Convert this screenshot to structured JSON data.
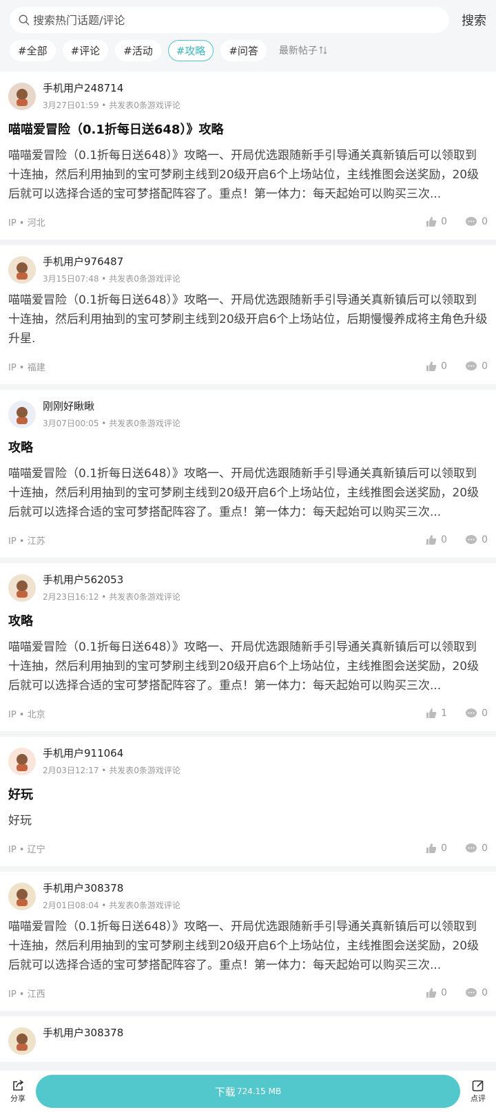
{
  "search": {
    "placeholder": "搜索热门话题/评论",
    "button": "搜索"
  },
  "tags": [
    "#全部",
    "#评论",
    "#活动",
    "#攻略",
    "#问答"
  ],
  "active_tag": "#攻略",
  "sort_label": "最新帖子",
  "posts": [
    {
      "user": "手机用户248714",
      "meta": "3月27日01:59 • 共发表0条游戏评论",
      "title": "喵喵爱冒险（0.1折每日送648）》攻略",
      "body": "喵喵爱冒险（0.1折每日送648）》攻略一、开局优选跟随新手引导通关真新镇后可以领取到十连抽，然后利用抽到的宝可梦刷主线到20级开启6个上场站位，主线推图会送奖励，20级后就可以选择合适的宝可梦搭配阵容了。重点！第一体力：每天起始可以购买三次...",
      "ip": "IP • 河北",
      "likes": "0",
      "comments": "0"
    },
    {
      "user": "手机用户976487",
      "meta": "3月15日07:48 • 共发表0条游戏评论",
      "title": "",
      "body": "喵喵爱冒险（0.1折每日送648）》攻略一、开局优选跟随新手引导通关真新镇后可以领取到十连抽，然后利用抽到的宝可梦刷主线到20级开启6个上场站位，后期慢慢养成将主角色升级升星.",
      "ip": "IP • 福建",
      "likes": "0",
      "comments": "0"
    },
    {
      "user": "刚刚好瞅瞅",
      "meta": "3月07日00:05 • 共发表0条游戏评论",
      "title": "攻略",
      "body": "喵喵爱冒险（0.1折每日送648）》攻略一、开局优选跟随新手引导通关真新镇后可以领取到十连抽，然后利用抽到的宝可梦刷主线到20级开启6个上场站位，主线推图会送奖励，20级后就可以选择合适的宝可梦搭配阵容了。重点！第一体力：每天起始可以购买三次...",
      "ip": "IP • 江苏",
      "likes": "0",
      "comments": "0"
    },
    {
      "user": "手机用户562053",
      "meta": "2月23日16:12 • 共发表0条游戏评论",
      "title": "攻略",
      "body": "喵喵爱冒险（0.1折每日送648）》攻略一、开局优选跟随新手引导通关真新镇后可以领取到十连抽，然后利用抽到的宝可梦刷主线到20级开启6个上场站位，主线推图会送奖励，20级后就可以选择合适的宝可梦搭配阵容了。重点！第一体力：每天起始可以购买三次...",
      "ip": "IP • 北京",
      "likes": "1",
      "comments": "0"
    },
    {
      "user": "手机用户911064",
      "meta": "2月03日12:17 • 共发表0条游戏评论",
      "title": "好玩",
      "body": "好玩",
      "ip": "IP • 辽宁",
      "likes": "0",
      "comments": "0"
    },
    {
      "user": "手机用户308378",
      "meta": "2月01日08:04 • 共发表0条游戏评论",
      "title": "",
      "body": "喵喵爱冒险（0.1折每日送648）》攻略一、开局优选跟随新手引导通关真新镇后可以领取到十连抽，然后利用抽到的宝可梦刷主线到20级开启6个上场站位，主线推图会送奖励，20级后就可以选择合适的宝可梦搭配阵容了。重点！第一体力：每天起始可以购买三次...",
      "ip": "IP • 江西",
      "likes": "0",
      "comments": "0"
    },
    {
      "user": "手机用户308378",
      "meta": "",
      "title": "",
      "body": "",
      "ip": "",
      "likes": "",
      "comments": ""
    }
  ],
  "bottom": {
    "share": "分享",
    "download": "下载",
    "size": "724.15 MB",
    "review": "点评"
  },
  "colors": {
    "accent": "#52c7cc",
    "tag_active": "#3ab6bc"
  }
}
